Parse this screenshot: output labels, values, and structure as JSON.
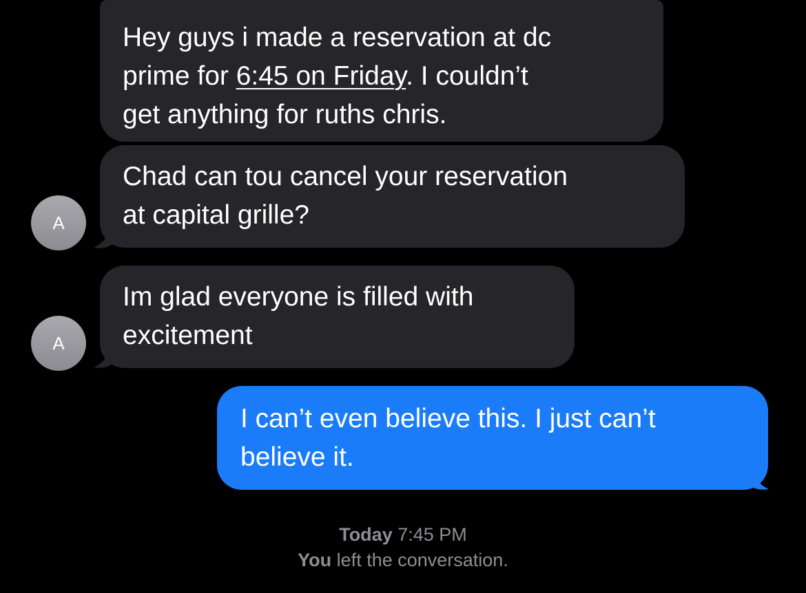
{
  "messages": [
    {
      "direction": "incoming",
      "line1": "Hey guys i made a reservation at dc",
      "line2_before": "prime for ",
      "line2_link": "6:45 on Friday",
      "line2_after": ". I couldn’t",
      "line3": "get anything for ruths chris."
    },
    {
      "direction": "incoming",
      "sender_initial": "A",
      "line1": "Chad can tou cancel your reservation",
      "line2": "at capital grille?"
    },
    {
      "direction": "incoming",
      "sender_initial": "A",
      "line1": "Im glad everyone is filled with",
      "line2": "excitement"
    },
    {
      "direction": "outgoing",
      "line1": "I can’t even believe this. I just can’t",
      "line2": "believe it."
    }
  ],
  "footer": {
    "day": "Today",
    "time": "7:45 PM",
    "actor": "You",
    "event": "left the conversation."
  },
  "colors": {
    "background": "#000000",
    "incoming_bubble": "#26252a",
    "outgoing_bubble": "#1a7cf8",
    "avatar": "#9a9aa0",
    "system_text": "#8e8e93"
  }
}
